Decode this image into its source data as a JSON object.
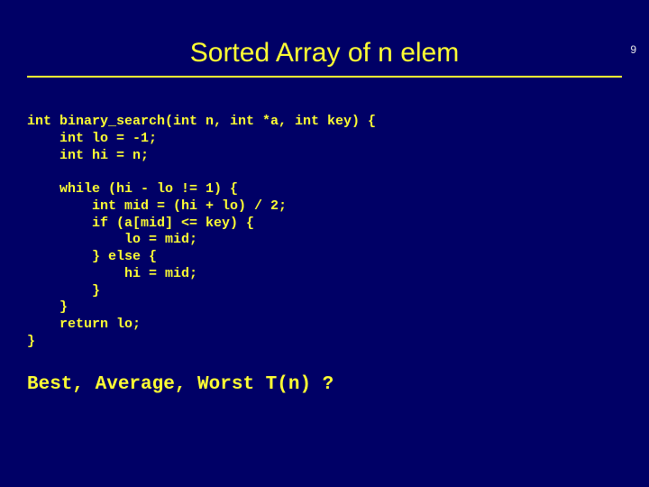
{
  "page_number": "9",
  "title": "Sorted Array of n elem",
  "code": "int binary_search(int n, int *a, int key) {\n    int lo = -1;\n    int hi = n;\n\n    while (hi - lo != 1) {\n        int mid = (hi + lo) / 2;\n        if (a[mid] <= key) {\n            lo = mid;\n        } else {\n            hi = mid;\n        }\n    }\n    return lo;\n}",
  "footer": "Best, Average, Worst T(n) ?"
}
